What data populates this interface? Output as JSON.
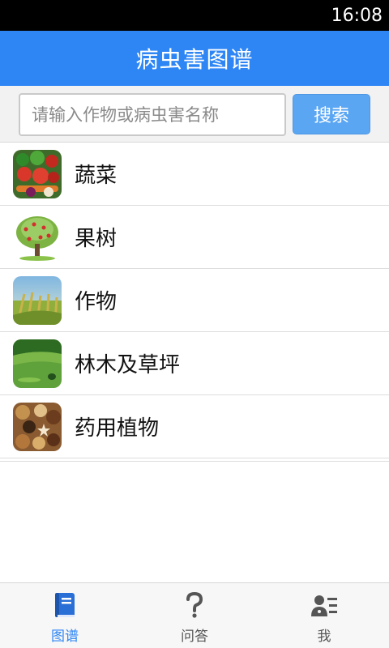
{
  "status_bar": {
    "time": "16:08"
  },
  "header": {
    "title": "病虫害图谱"
  },
  "search": {
    "placeholder": "请输入作物或病虫害名称",
    "button_label": "搜索"
  },
  "categories": [
    {
      "label": "蔬菜",
      "icon": "vegetables-thumbnail"
    },
    {
      "label": "果树",
      "icon": "fruit-tree-thumbnail"
    },
    {
      "label": "作物",
      "icon": "crops-thumbnail"
    },
    {
      "label": "林木及草坪",
      "icon": "forest-lawn-thumbnail"
    },
    {
      "label": "药用植物",
      "icon": "medicinal-plants-thumbnail"
    }
  ],
  "tabs": [
    {
      "label": "图谱",
      "icon": "book-icon",
      "active": true
    },
    {
      "label": "问答",
      "icon": "question-icon",
      "active": false
    },
    {
      "label": "我",
      "icon": "profile-icon",
      "active": false
    }
  ],
  "colors": {
    "accent": "#2e86f5",
    "search_button": "#5aa6f3",
    "status_bar": "#000000"
  }
}
